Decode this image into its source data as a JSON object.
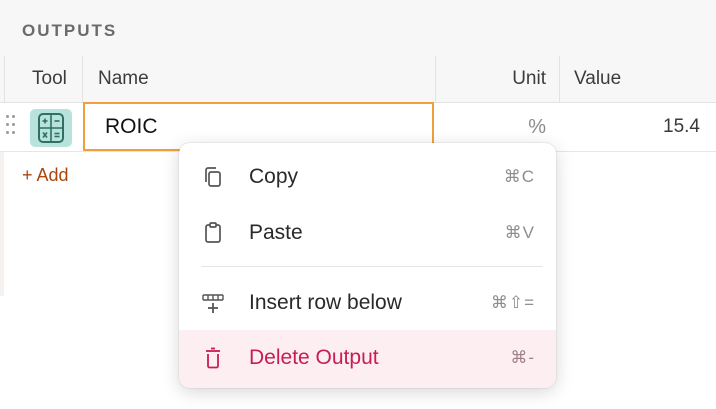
{
  "section": {
    "title": "OUTPUTS"
  },
  "table": {
    "columns": {
      "tool": "Tool",
      "name": "Name",
      "unit": "Unit",
      "value": "Value"
    },
    "rows": [
      {
        "tool_icon": "calculator-icon",
        "name": "ROIC",
        "unit": "%",
        "value": "15.4"
      }
    ]
  },
  "add_label": "+ Add",
  "context_menu": {
    "items": [
      {
        "icon": "copy-icon",
        "label": "Copy",
        "shortcut": "⌘C"
      },
      {
        "icon": "clipboard-icon",
        "label": "Paste",
        "shortcut": "⌘V"
      },
      {
        "icon": "insert-row-icon",
        "label": "Insert row below",
        "shortcut": "⌘⇧="
      },
      {
        "icon": "trash-icon",
        "label": "Delete Output",
        "shortcut": "⌘-"
      }
    ]
  },
  "colors": {
    "accent_orange": "#f0a03a",
    "add_link": "#a8480e",
    "danger": "#c81d54",
    "danger_bg": "#fdeff1",
    "tool_icon_bg": "#b7e3dc"
  }
}
